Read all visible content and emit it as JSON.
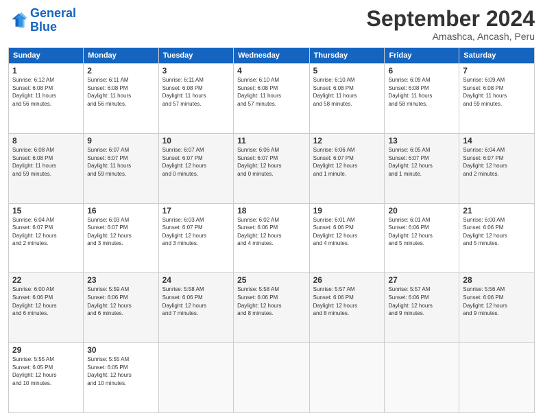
{
  "header": {
    "logo_line1": "General",
    "logo_line2": "Blue",
    "month": "September 2024",
    "location": "Amashca, Ancash, Peru"
  },
  "days_of_week": [
    "Sunday",
    "Monday",
    "Tuesday",
    "Wednesday",
    "Thursday",
    "Friday",
    "Saturday"
  ],
  "weeks": [
    [
      {
        "num": "1",
        "info": "Sunrise: 6:12 AM\nSunset: 6:08 PM\nDaylight: 11 hours\nand 56 minutes."
      },
      {
        "num": "2",
        "info": "Sunrise: 6:11 AM\nSunset: 6:08 PM\nDaylight: 11 hours\nand 56 minutes."
      },
      {
        "num": "3",
        "info": "Sunrise: 6:11 AM\nSunset: 6:08 PM\nDaylight: 11 hours\nand 57 minutes."
      },
      {
        "num": "4",
        "info": "Sunrise: 6:10 AM\nSunset: 6:08 PM\nDaylight: 11 hours\nand 57 minutes."
      },
      {
        "num": "5",
        "info": "Sunrise: 6:10 AM\nSunset: 6:08 PM\nDaylight: 11 hours\nand 58 minutes."
      },
      {
        "num": "6",
        "info": "Sunrise: 6:09 AM\nSunset: 6:08 PM\nDaylight: 11 hours\nand 58 minutes."
      },
      {
        "num": "7",
        "info": "Sunrise: 6:09 AM\nSunset: 6:08 PM\nDaylight: 11 hours\nand 59 minutes."
      }
    ],
    [
      {
        "num": "8",
        "info": "Sunrise: 6:08 AM\nSunset: 6:08 PM\nDaylight: 11 hours\nand 59 minutes."
      },
      {
        "num": "9",
        "info": "Sunrise: 6:07 AM\nSunset: 6:07 PM\nDaylight: 11 hours\nand 59 minutes."
      },
      {
        "num": "10",
        "info": "Sunrise: 6:07 AM\nSunset: 6:07 PM\nDaylight: 12 hours\nand 0 minutes."
      },
      {
        "num": "11",
        "info": "Sunrise: 6:06 AM\nSunset: 6:07 PM\nDaylight: 12 hours\nand 0 minutes."
      },
      {
        "num": "12",
        "info": "Sunrise: 6:06 AM\nSunset: 6:07 PM\nDaylight: 12 hours\nand 1 minute."
      },
      {
        "num": "13",
        "info": "Sunrise: 6:05 AM\nSunset: 6:07 PM\nDaylight: 12 hours\nand 1 minute."
      },
      {
        "num": "14",
        "info": "Sunrise: 6:04 AM\nSunset: 6:07 PM\nDaylight: 12 hours\nand 2 minutes."
      }
    ],
    [
      {
        "num": "15",
        "info": "Sunrise: 6:04 AM\nSunset: 6:07 PM\nDaylight: 12 hours\nand 2 minutes."
      },
      {
        "num": "16",
        "info": "Sunrise: 6:03 AM\nSunset: 6:07 PM\nDaylight: 12 hours\nand 3 minutes."
      },
      {
        "num": "17",
        "info": "Sunrise: 6:03 AM\nSunset: 6:07 PM\nDaylight: 12 hours\nand 3 minutes."
      },
      {
        "num": "18",
        "info": "Sunrise: 6:02 AM\nSunset: 6:06 PM\nDaylight: 12 hours\nand 4 minutes."
      },
      {
        "num": "19",
        "info": "Sunrise: 6:01 AM\nSunset: 6:06 PM\nDaylight: 12 hours\nand 4 minutes."
      },
      {
        "num": "20",
        "info": "Sunrise: 6:01 AM\nSunset: 6:06 PM\nDaylight: 12 hours\nand 5 minutes."
      },
      {
        "num": "21",
        "info": "Sunrise: 6:00 AM\nSunset: 6:06 PM\nDaylight: 12 hours\nand 5 minutes."
      }
    ],
    [
      {
        "num": "22",
        "info": "Sunrise: 6:00 AM\nSunset: 6:06 PM\nDaylight: 12 hours\nand 6 minutes."
      },
      {
        "num": "23",
        "info": "Sunrise: 5:59 AM\nSunset: 6:06 PM\nDaylight: 12 hours\nand 6 minutes."
      },
      {
        "num": "24",
        "info": "Sunrise: 5:58 AM\nSunset: 6:06 PM\nDaylight: 12 hours\nand 7 minutes."
      },
      {
        "num": "25",
        "info": "Sunrise: 5:58 AM\nSunset: 6:06 PM\nDaylight: 12 hours\nand 8 minutes."
      },
      {
        "num": "26",
        "info": "Sunrise: 5:57 AM\nSunset: 6:06 PM\nDaylight: 12 hours\nand 8 minutes."
      },
      {
        "num": "27",
        "info": "Sunrise: 5:57 AM\nSunset: 6:06 PM\nDaylight: 12 hours\nand 9 minutes."
      },
      {
        "num": "28",
        "info": "Sunrise: 5:56 AM\nSunset: 6:06 PM\nDaylight: 12 hours\nand 9 minutes."
      }
    ],
    [
      {
        "num": "29",
        "info": "Sunrise: 5:55 AM\nSunset: 6:05 PM\nDaylight: 12 hours\nand 10 minutes."
      },
      {
        "num": "30",
        "info": "Sunrise: 5:55 AM\nSunset: 6:05 PM\nDaylight: 12 hours\nand 10 minutes."
      },
      {
        "num": "",
        "info": ""
      },
      {
        "num": "",
        "info": ""
      },
      {
        "num": "",
        "info": ""
      },
      {
        "num": "",
        "info": ""
      },
      {
        "num": "",
        "info": ""
      }
    ]
  ]
}
